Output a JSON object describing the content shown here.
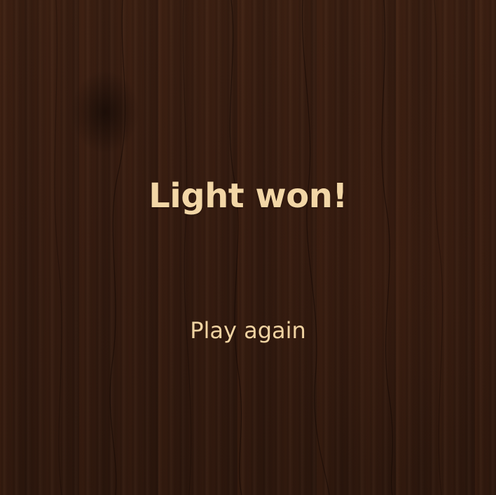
{
  "game_over": {
    "title": "Light won!",
    "play_again_label": "Play again"
  },
  "colors": {
    "text": "#f2d6a6",
    "wood_dark": "#2c170d",
    "wood_mid": "#3a1f12"
  }
}
